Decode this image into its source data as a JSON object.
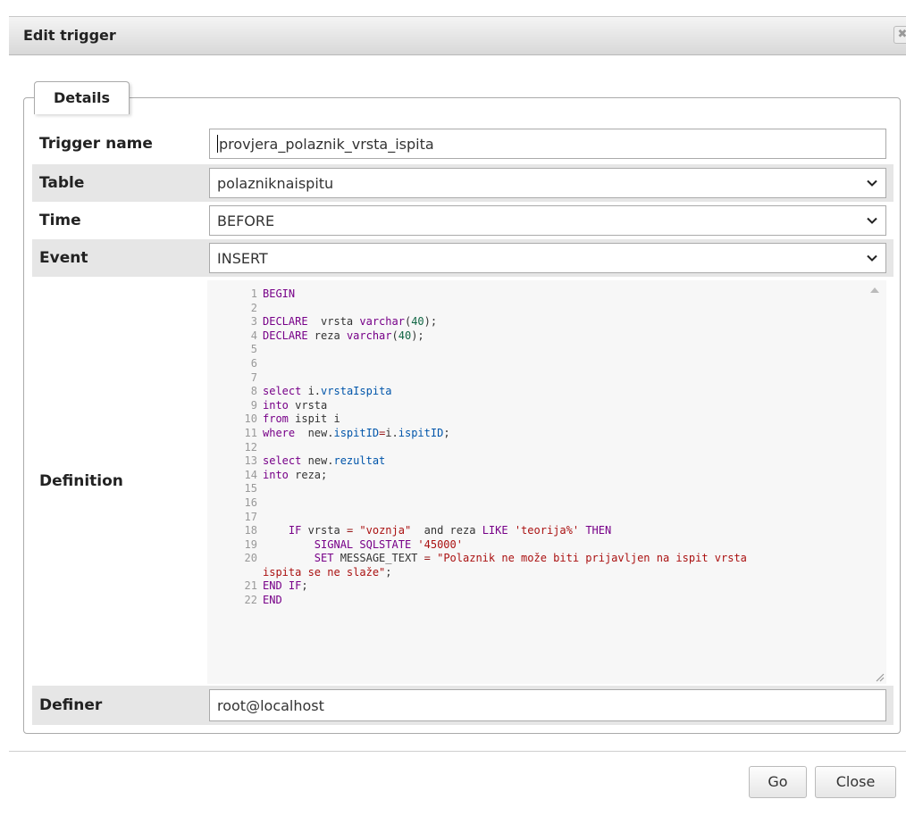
{
  "dialog": {
    "title": "Edit trigger",
    "close_glyph": "✖"
  },
  "fieldset": {
    "legend": "Details"
  },
  "fields": {
    "trigger_name": {
      "label": "Trigger name",
      "value": "provjera_polaznik_vrsta_ispita"
    },
    "table": {
      "label": "Table",
      "value": "polazniknaispitu"
    },
    "time": {
      "label": "Time",
      "value": "BEFORE"
    },
    "event": {
      "label": "Event",
      "value": "INSERT"
    },
    "definition": {
      "label": "Definition"
    },
    "definer": {
      "label": "Definer",
      "value": "root@localhost"
    }
  },
  "definition_lines": [
    {
      "n": "1",
      "tokens": [
        [
          "kw",
          "BEGIN"
        ]
      ]
    },
    {
      "n": "2",
      "tokens": []
    },
    {
      "n": "3",
      "tokens": [
        [
          "kw",
          "DECLARE"
        ],
        [
          "",
          "  vrsta "
        ],
        [
          "ty",
          "varchar"
        ],
        [
          "",
          "("
        ],
        [
          "nm",
          "40"
        ],
        [
          "",
          ");"
        ]
      ]
    },
    {
      "n": "4",
      "tokens": [
        [
          "kw",
          "DECLARE"
        ],
        [
          "",
          " reza "
        ],
        [
          "ty",
          "varchar"
        ],
        [
          "",
          "("
        ],
        [
          "nm",
          "40"
        ],
        [
          "",
          ");"
        ]
      ]
    },
    {
      "n": "5",
      "tokens": []
    },
    {
      "n": "6",
      "tokens": []
    },
    {
      "n": "7",
      "tokens": []
    },
    {
      "n": "8",
      "tokens": [
        [
          "kw",
          "select"
        ],
        [
          "",
          " i."
        ],
        [
          "fn",
          "vrstaIspita"
        ]
      ]
    },
    {
      "n": "9",
      "tokens": [
        [
          "kw",
          "into"
        ],
        [
          "",
          " vrsta"
        ]
      ]
    },
    {
      "n": "10",
      "tokens": [
        [
          "kw",
          "from"
        ],
        [
          "",
          " ispit i"
        ]
      ]
    },
    {
      "n": "11",
      "tokens": [
        [
          "kw",
          "where"
        ],
        [
          "",
          "  new."
        ],
        [
          "fn",
          "ispitID"
        ],
        [
          "op",
          "="
        ],
        [
          "",
          "i."
        ],
        [
          "fn",
          "ispitID"
        ],
        [
          "",
          ";"
        ]
      ]
    },
    {
      "n": "12",
      "tokens": []
    },
    {
      "n": "13",
      "tokens": [
        [
          "kw",
          "select"
        ],
        [
          "",
          " new."
        ],
        [
          "fn",
          "rezultat"
        ]
      ]
    },
    {
      "n": "14",
      "tokens": [
        [
          "kw",
          "into"
        ],
        [
          "",
          " reza;"
        ]
      ]
    },
    {
      "n": "15",
      "tokens": []
    },
    {
      "n": "16",
      "tokens": []
    },
    {
      "n": "17",
      "tokens": []
    },
    {
      "n": "18",
      "tokens": [
        [
          "",
          "    "
        ],
        [
          "kw",
          "IF"
        ],
        [
          "",
          " vrsta "
        ],
        [
          "op",
          "="
        ],
        [
          "",
          " "
        ],
        [
          "st",
          "\"voznja\""
        ],
        [
          "",
          "  and reza "
        ],
        [
          "kw",
          "LIKE"
        ],
        [
          "",
          " "
        ],
        [
          "st",
          "'teorija%'"
        ],
        [
          "",
          " "
        ],
        [
          "kw",
          "THEN"
        ]
      ]
    },
    {
      "n": "19",
      "tokens": [
        [
          "",
          "        "
        ],
        [
          "kw",
          "SIGNAL SQLSTATE"
        ],
        [
          "",
          " "
        ],
        [
          "st",
          "'45000'"
        ]
      ]
    },
    {
      "n": "20",
      "tokens": [
        [
          "",
          "        "
        ],
        [
          "kw",
          "SET"
        ],
        [
          "",
          " MESSAGE_TEXT "
        ],
        [
          "op",
          "="
        ],
        [
          "",
          " "
        ],
        [
          "st",
          "\"Polaznik ne može biti prijavljen na ispit vrsta"
        ]
      ]
    },
    {
      "n": "",
      "tokens": [
        [
          "st",
          "ispita se ne slaže\""
        ],
        [
          "",
          ";"
        ]
      ]
    },
    {
      "n": "21",
      "tokens": [
        [
          "kw",
          "END IF"
        ],
        [
          "",
          ";"
        ]
      ]
    },
    {
      "n": "22",
      "tokens": [
        [
          "kw",
          "END"
        ]
      ]
    }
  ],
  "buttons": {
    "go": "Go",
    "close": "Close"
  }
}
